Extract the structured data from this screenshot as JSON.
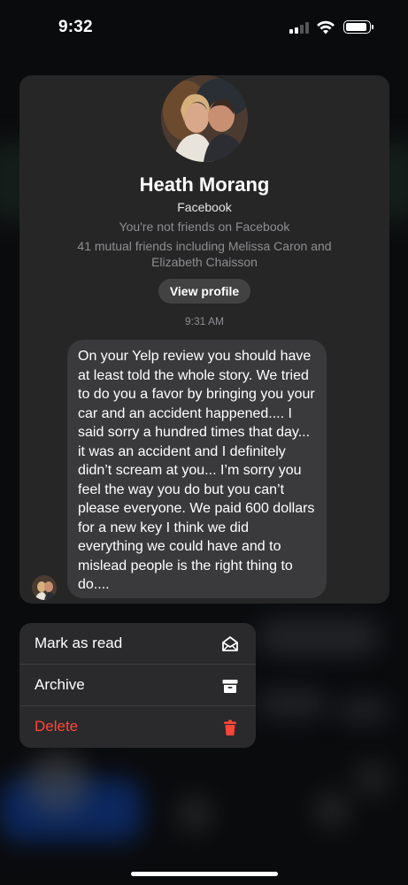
{
  "status_bar": {
    "time": "9:32"
  },
  "profile": {
    "name": "Heath Morang",
    "platform": "Facebook",
    "friend_status": "You're not friends on Facebook",
    "mutual_friends": "41 mutual friends including Melissa Caron and Elizabeth Chaisson",
    "view_profile_label": "View profile"
  },
  "message": {
    "timestamp": "9:31 AM",
    "text": "On your Yelp review you should have at least told the whole story. We tried to do you a favor by bringing you your car and an accident happened.... I said sorry a hundred times that day... it was an accident and I definitely didn’t scream at you... I’m sorry you feel the way you do but you can’t please everyone. We paid 600 dollars for a new key I think we did everything we could have and to mislead people is the right thing to do...."
  },
  "menu": {
    "items": [
      {
        "label": "Mark as read",
        "icon": "envelope-open-icon"
      },
      {
        "label": "Archive",
        "icon": "archive-box-icon"
      },
      {
        "label": "Delete",
        "icon": "trash-icon",
        "color": "#ff453a"
      }
    ]
  },
  "colors": {
    "card_bg": "#262626",
    "bubble_bg": "#3a3a3c",
    "danger": "#ff453a"
  }
}
